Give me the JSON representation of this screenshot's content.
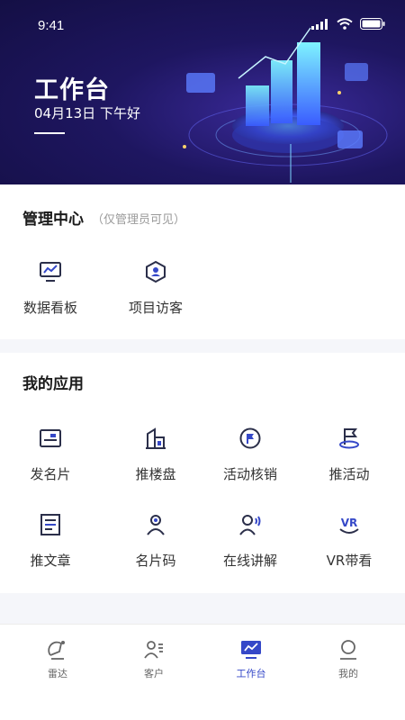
{
  "status_bar": {
    "time": "9:41"
  },
  "header": {
    "title": "工作台",
    "subtitle": "04月13日 下午好"
  },
  "admin_section": {
    "title": "管理中心",
    "note": "（仅管理员可见）",
    "items": [
      {
        "label": "数据看板",
        "icon": "dashboard-monitor-icon"
      },
      {
        "label": "项目访客",
        "icon": "hexagon-visitor-icon"
      }
    ]
  },
  "apps_section": {
    "title": "我的应用",
    "items": [
      {
        "label": "发名片",
        "icon": "business-card-icon"
      },
      {
        "label": "推楼盘",
        "icon": "building-icon"
      },
      {
        "label": "活动核销",
        "icon": "flag-circle-icon"
      },
      {
        "label": "推活动",
        "icon": "flag-pin-icon"
      },
      {
        "label": "推文章",
        "icon": "article-icon"
      },
      {
        "label": "名片码",
        "icon": "person-code-icon"
      },
      {
        "label": "在线讲解",
        "icon": "person-voice-icon"
      },
      {
        "label": "VR带看",
        "icon": "vr-icon"
      }
    ]
  },
  "bottom_nav": {
    "items": [
      {
        "label": "雷达",
        "icon": "radar-icon",
        "active": false
      },
      {
        "label": "客户",
        "icon": "customers-icon",
        "active": false
      },
      {
        "label": "工作台",
        "icon": "workbench-icon",
        "active": true
      },
      {
        "label": "我的",
        "icon": "profile-icon",
        "active": false
      }
    ]
  },
  "colors": {
    "accent": "#3548c8",
    "icon_dark": "#2b2f4a",
    "header_bg": "#1e1660"
  }
}
